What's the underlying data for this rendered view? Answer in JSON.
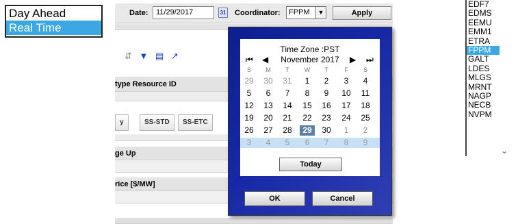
{
  "market": {
    "options": [
      "Day Ahead",
      "Real Time"
    ],
    "selected_index": 1
  },
  "toolbar": {
    "date_label": "Date:",
    "date_value": "11/29/2017",
    "calendar_button": "31",
    "coordinator_label": "Coordinator:",
    "coordinator_value": "FPPM",
    "apply_label": "Apply"
  },
  "grid": {
    "type_resource_header": "type Resource ID",
    "tabs": [
      "y",
      "SS-STD",
      "SS-ETC"
    ],
    "range_up_header": "ge Up",
    "price_header": "rice [$/MW]"
  },
  "calendar": {
    "timezone": "Time Zone :PST",
    "month": "November 2017",
    "weekdays": [
      "S",
      "M",
      "T",
      "W",
      "T",
      "F",
      "S"
    ],
    "weeks": [
      [
        {
          "d": "29",
          "o": true
        },
        {
          "d": "30",
          "o": true
        },
        {
          "d": "31",
          "o": true
        },
        {
          "d": "1"
        },
        {
          "d": "2"
        },
        {
          "d": "3"
        },
        {
          "d": "4"
        }
      ],
      [
        {
          "d": "5"
        },
        {
          "d": "6"
        },
        {
          "d": "7"
        },
        {
          "d": "8"
        },
        {
          "d": "9"
        },
        {
          "d": "10"
        },
        {
          "d": "11"
        }
      ],
      [
        {
          "d": "12"
        },
        {
          "d": "13"
        },
        {
          "d": "14"
        },
        {
          "d": "15"
        },
        {
          "d": "16"
        },
        {
          "d": "17"
        },
        {
          "d": "18"
        }
      ],
      [
        {
          "d": "19"
        },
        {
          "d": "20"
        },
        {
          "d": "21"
        },
        {
          "d": "22"
        },
        {
          "d": "23"
        },
        {
          "d": "24"
        },
        {
          "d": "25"
        }
      ],
      [
        {
          "d": "26"
        },
        {
          "d": "27"
        },
        {
          "d": "28"
        },
        {
          "d": "29",
          "s": true
        },
        {
          "d": "30"
        },
        {
          "d": "1",
          "o": true
        },
        {
          "d": "2",
          "o": true
        }
      ],
      [
        {
          "d": "3",
          "o": true
        },
        {
          "d": "4",
          "o": true
        },
        {
          "d": "5",
          "o": true
        },
        {
          "d": "6",
          "o": true
        },
        {
          "d": "7",
          "o": true
        },
        {
          "d": "8",
          "o": true
        },
        {
          "d": "9",
          "o": true
        }
      ]
    ],
    "today_label": "Today",
    "ok_label": "OK",
    "cancel_label": "Cancel"
  },
  "coordinators": {
    "items": [
      "EDF7",
      "EDMS",
      "EEMU",
      "EMM1",
      "ETRA",
      "FPPM",
      "GALT",
      "LDES",
      "MLGS",
      "MRNT",
      "NAGP",
      "NECB",
      "NVPM"
    ],
    "selected": "FPPM"
  },
  "colors": {
    "selection_blue": "#3ba7e3",
    "calendar_frame": "#1628a6",
    "selected_day": "#5a80a8"
  }
}
